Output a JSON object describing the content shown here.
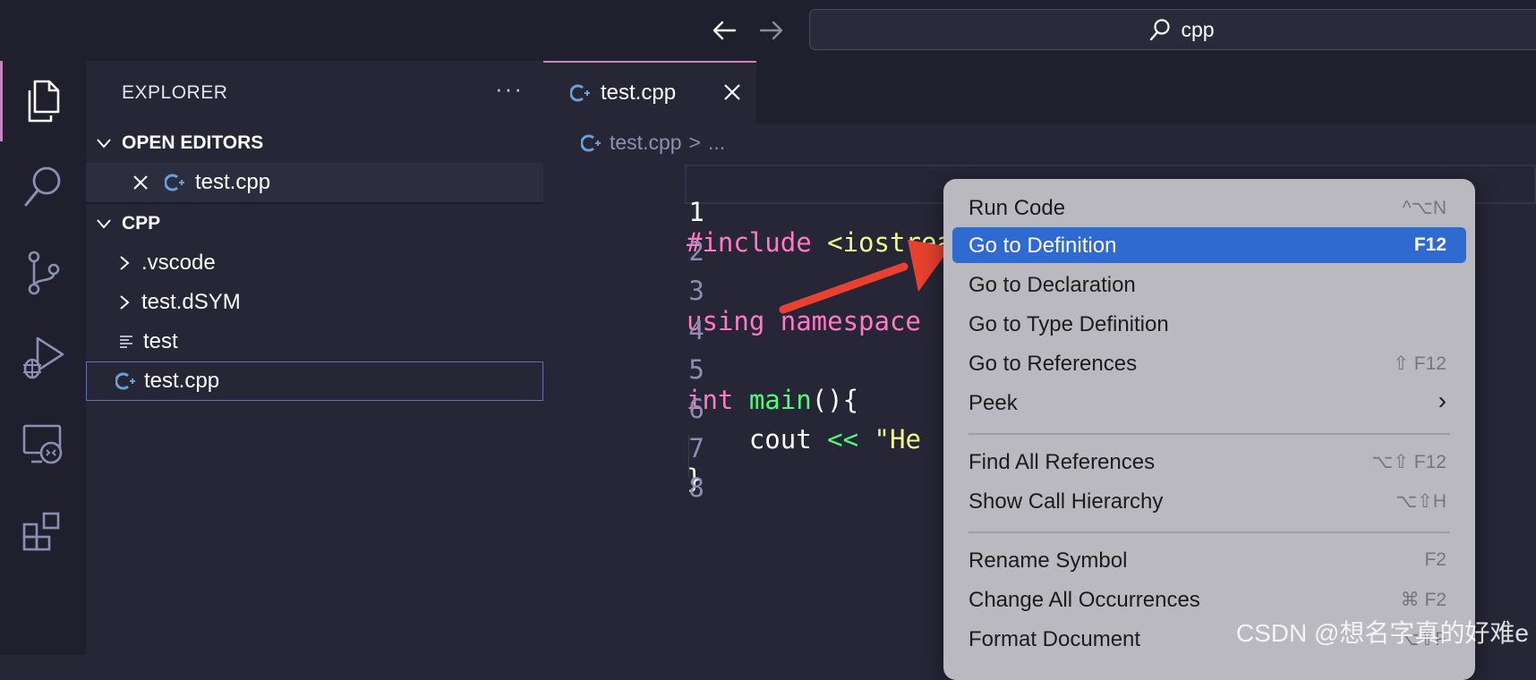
{
  "titlebar": {
    "search_text": "cpp"
  },
  "activitybar": {
    "items": [
      "explorer-icon",
      "search-icon",
      "source-control-icon",
      "run-debug-icon",
      "remote-explorer-icon",
      "extensions-icon"
    ]
  },
  "sidebar": {
    "title": "EXPLORER",
    "more": "···",
    "open_editors": {
      "header": "OPEN EDITORS",
      "files": [
        "test.cpp"
      ]
    },
    "folder": {
      "header": "CPP",
      "items": [
        {
          "label": ".vscode",
          "kind": "folder"
        },
        {
          "label": "test.dSYM",
          "kind": "folder"
        },
        {
          "label": "test",
          "kind": "file"
        },
        {
          "label": "test.cpp",
          "kind": "cpp"
        }
      ]
    }
  },
  "editor": {
    "tab_label": "test.cpp",
    "breadcrumb": {
      "file": "test.cpp",
      "sep": ">",
      "rest": "..."
    },
    "line_numbers": [
      "1",
      "2",
      "3",
      "4",
      "5",
      "6",
      "7",
      "8"
    ],
    "lines": {
      "l1_a": "#include ",
      "l1_b": "<iostream>",
      "l3_a": "using namespace",
      "l5_a": "int",
      "l5_b": " main",
      "l5_c": "(){",
      "l6_a": "    cout ",
      "l6_b": "<<",
      "l6_c": " \"He",
      "l7_a": "}"
    }
  },
  "context_menu": {
    "items": [
      {
        "label": "Run Code",
        "shortcut": "^⌥N"
      },
      {
        "label": "Go to Definition",
        "shortcut": "F12",
        "highlighted": true
      },
      {
        "label": "Go to Declaration",
        "shortcut": ""
      },
      {
        "label": "Go to Type Definition",
        "shortcut": ""
      },
      {
        "label": "Go to References",
        "shortcut": "⇧ F12"
      },
      {
        "label": "Peek",
        "shortcut": "›"
      },
      {
        "label": "Find All References",
        "shortcut": "⌥⇧ F12"
      },
      {
        "label": "Show Call Hierarchy",
        "shortcut": "⌥⇧H"
      },
      {
        "label": "Rename Symbol",
        "shortcut": "F2"
      },
      {
        "label": "Change All Occurrences",
        "shortcut": "⌘ F2"
      },
      {
        "label": "Format Document",
        "shortcut": "⌥⇧F"
      }
    ]
  },
  "watermark": "CSDN @想名字真的好难e",
  "colors": {
    "accent": "#c586c0",
    "menu_highlight": "#2f6ad0",
    "arrow": "#e8412f"
  }
}
